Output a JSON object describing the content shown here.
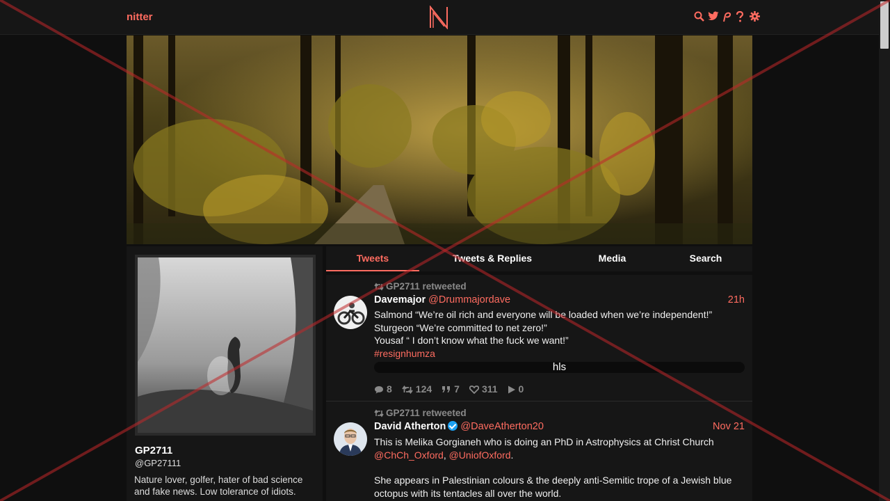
{
  "nav": {
    "brand": "nitter",
    "icons": [
      "search-icon",
      "twitter-icon",
      "rss-icon",
      "help-icon",
      "gear-icon"
    ]
  },
  "colors": {
    "accent": "#ff6c60",
    "background": "#0f0f0f",
    "panel": "#161616",
    "muted": "#8a8a8a"
  },
  "profile": {
    "fullname": "GP2711",
    "username": "@GP27111",
    "bio": "Nature lover, golfer, hater of bad science and fake news. Low tolerance of idiots."
  },
  "tabs": [
    {
      "label": "Tweets",
      "active": true
    },
    {
      "label": "Tweets & Replies",
      "active": false
    },
    {
      "label": "Media",
      "active": false
    },
    {
      "label": "Search",
      "active": false
    }
  ],
  "tweets": [
    {
      "retweet_text": "GP2711 retweeted",
      "fullname": "Davemajor",
      "username": "@Drummajordave",
      "date": "21h",
      "lines": [
        "Salmond “We’re oil rich and everyone will be loaded when we’re independent!”",
        "Sturgeon “We’re committed to net zero!”",
        "Yousaf “ I don’t know what the fuck we want!”"
      ],
      "hashtag": "#resignhumza",
      "video_label": "hls",
      "stats": {
        "replies": "8",
        "retweets": "124",
        "quotes": "7",
        "likes": "311",
        "views": "0"
      }
    },
    {
      "retweet_text": "GP2711 retweeted",
      "fullname": "David Atherton",
      "username": "@DaveAtherton20",
      "date": "Nov 21",
      "line1": "This is Melika Gorgianeh who is doing an PhD in Astrophysics at Christ Church",
      "mention1": "@ChCh_Oxford",
      "sep": ",",
      "mention2": "@UniofOxford",
      "end": ".",
      "line2": "She appears in Palestinian colours & the deeply anti-Semitic trope of a Jewish blue octopus with its tentacles all over the world."
    }
  ]
}
